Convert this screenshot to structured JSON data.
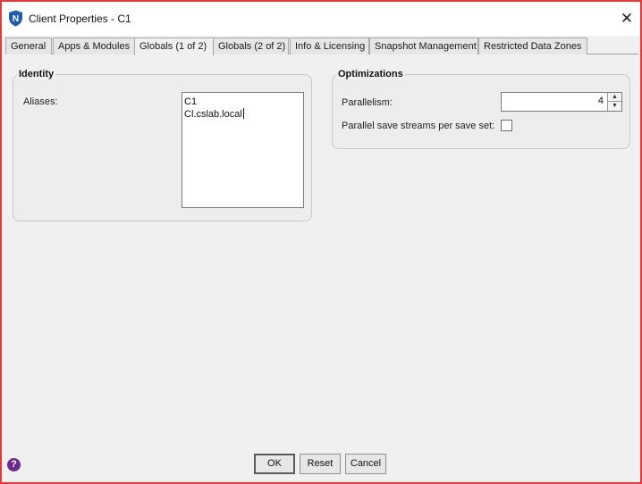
{
  "window": {
    "title": "Client Properties - C1",
    "close_glyph": "✕",
    "app_icon_letter": "N"
  },
  "tabs": [
    {
      "label": "General",
      "active": false
    },
    {
      "label": "Apps & Modules",
      "active": false
    },
    {
      "label": "Globals (1 of 2)",
      "active": true
    },
    {
      "label": "Globals (2 of 2)",
      "active": false
    },
    {
      "label": "Info & Licensing",
      "active": false
    },
    {
      "label": "Snapshot Management",
      "active": false
    },
    {
      "label": "Restricted Data Zones",
      "active": false
    }
  ],
  "identity": {
    "title": "Identity",
    "aliases_label": "Aliases:",
    "aliases": [
      "C1",
      "Cl.cslab.local"
    ]
  },
  "optimizations": {
    "title": "Optimizations",
    "parallelism_label": "Parallelism:",
    "parallelism_value": "4",
    "parallel_streams_label": "Parallel save streams per save set:",
    "parallel_streams_checked": false
  },
  "footer": {
    "help_glyph": "?",
    "ok_label": "OK",
    "reset_label": "Reset",
    "cancel_label": "Cancel"
  },
  "colors": {
    "window_border": "#e23a3a",
    "help_icon": "#6a2a8c",
    "app_icon": "#1f5fa8"
  }
}
